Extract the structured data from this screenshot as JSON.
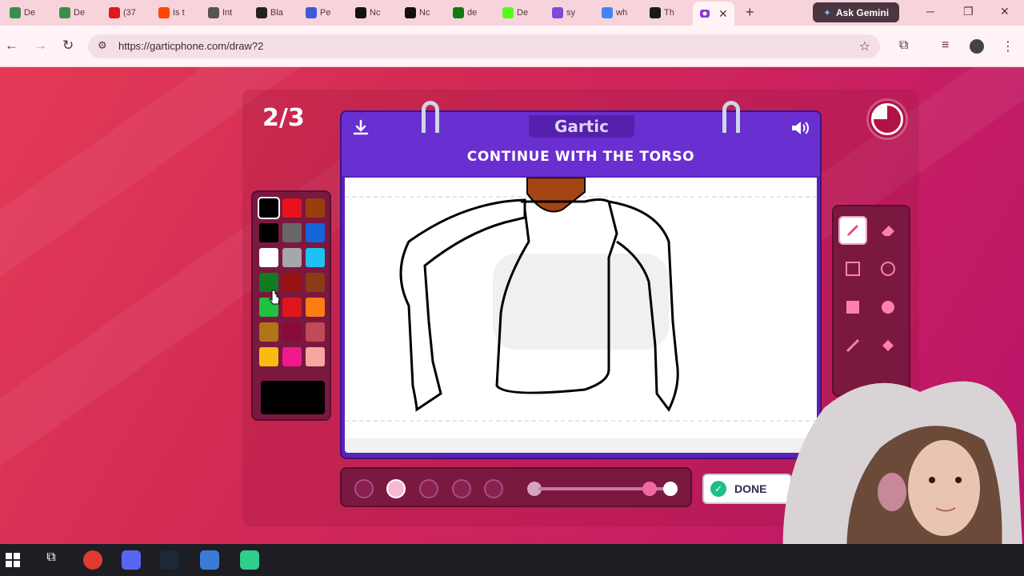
{
  "browser": {
    "tabs": [
      {
        "label": "De",
        "icon": "drive-icon",
        "color": "#3c8f4a"
      },
      {
        "label": "De",
        "icon": "drive-icon",
        "color": "#3c8f4a"
      },
      {
        "label": "(37",
        "icon": "youtube-icon",
        "color": "#e01818"
      },
      {
        "label": "Is t",
        "icon": "reddit-icon",
        "color": "#ff4500"
      },
      {
        "label": "Int",
        "icon": "globe-icon",
        "color": "#555555"
      },
      {
        "label": "Bla",
        "icon": "wix-icon",
        "color": "#222222"
      },
      {
        "label": "Pe",
        "icon": "site-icon",
        "color": "#3b5bd6"
      },
      {
        "label": "Nc",
        "icon": "x-icon",
        "color": "#111111"
      },
      {
        "label": "Nc",
        "icon": "x-icon",
        "color": "#111111"
      },
      {
        "label": "de",
        "icon": "xbox-icon",
        "color": "#107c10"
      },
      {
        "label": "De",
        "icon": "kick-icon",
        "color": "#53fc18"
      },
      {
        "label": "sy",
        "icon": "peace-icon",
        "color": "#7b4bd6"
      },
      {
        "label": "wh",
        "icon": "google-icon",
        "color": "#4285f4"
      },
      {
        "label": "Th",
        "icon": "terminal-icon",
        "color": "#1a1a1a"
      }
    ],
    "active_tab_icon": "gartic-icon",
    "new_tab": "+",
    "gemini_label": "Ask Gemini",
    "url": "https://garticphone.com/draw?2"
  },
  "game": {
    "round": "2/3",
    "brand": "Gartic",
    "prompt": "CONTINUE WITH THE TORSO",
    "done_label": "DONE",
    "palette": [
      [
        "#000000",
        "#e8121e",
        "#9a3f0b"
      ],
      [
        "#000000",
        "#676767",
        "#1565d8"
      ],
      [
        "#ffffff",
        "#a7a7a7",
        "#1fc0f2"
      ],
      [
        "#107b20",
        "#991010",
        "#8a3c14"
      ],
      [
        "#22c042",
        "#e0161e",
        "#fb7d14"
      ],
      [
        "#b0741a",
        "#8a0a3c",
        "#c04a55"
      ],
      [
        "#f9bb10",
        "#ee1a8c",
        "#f7a89e"
      ]
    ],
    "selected_color": "#000000",
    "tools": [
      "pencil-icon",
      "eraser-icon",
      "rectangle-outline-icon",
      "circle-outline-icon",
      "rectangle-fill-icon",
      "circle-fill-icon",
      "line-icon",
      "fill-bucket-icon"
    ],
    "selected_tool": "pencil-icon",
    "brush_size_selected_index": 1,
    "opacity": 1.0
  },
  "taskbar": {
    "apps": [
      "windows-start-icon",
      "task-view-icon",
      "chrome-icon",
      "discord-icon",
      "steam-icon",
      "roblox-icon",
      "android-icon"
    ]
  }
}
